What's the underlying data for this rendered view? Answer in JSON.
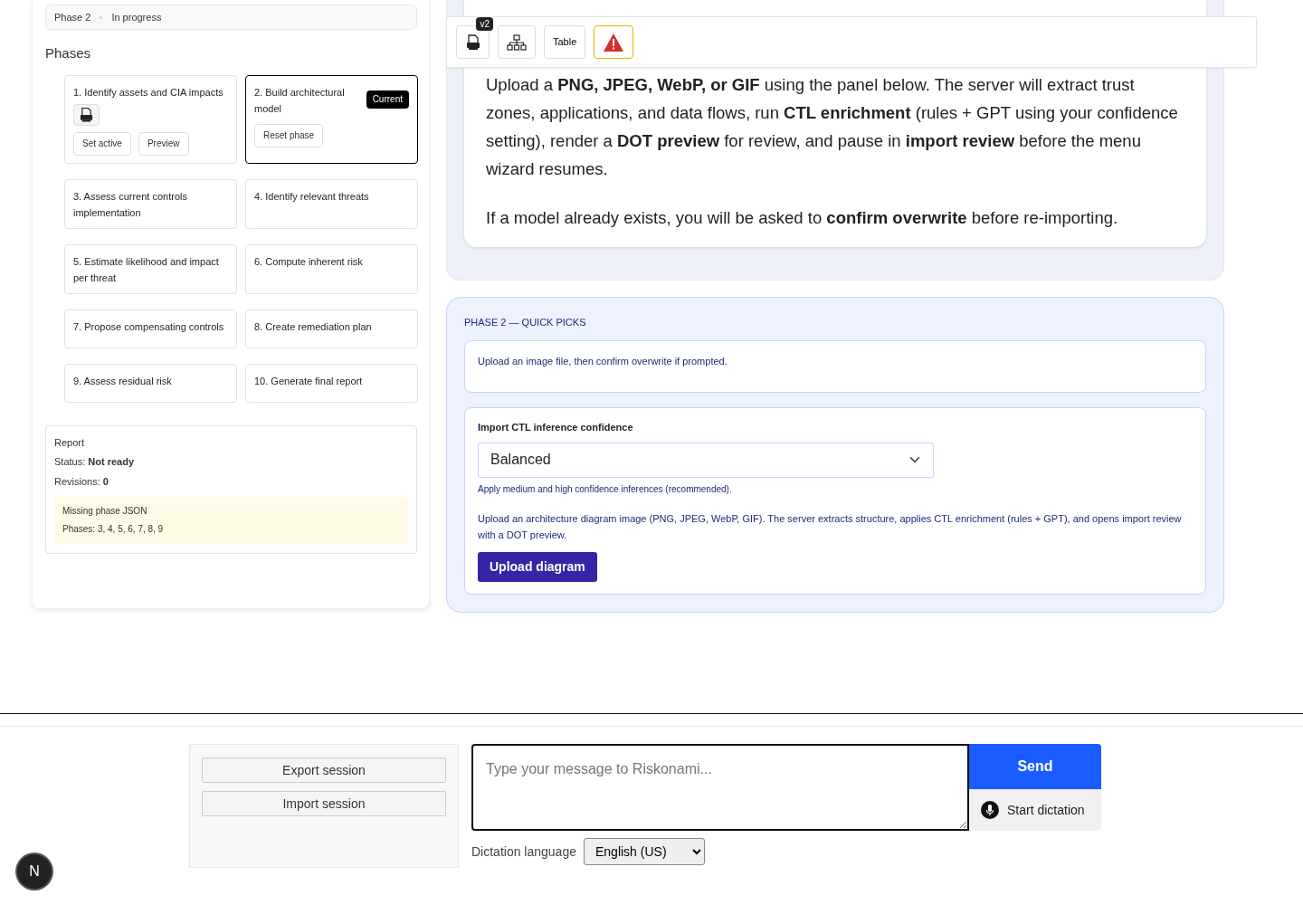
{
  "status_bar": {
    "phase": "Phase 2",
    "status": "In progress"
  },
  "phases_heading": "Phases",
  "phases": [
    {
      "label": "1. Identify assets and CIA impacts",
      "selected": false,
      "has_json": true,
      "actions": [
        "Set active",
        "Preview"
      ]
    },
    {
      "label": "2. Build architectural model",
      "selected": true,
      "badge": "Current",
      "has_json": false,
      "actions": [
        "Reset phase"
      ]
    },
    {
      "label": "3. Assess current controls implementation",
      "selected": false,
      "has_json": false
    },
    {
      "label": "4. Identify relevant threats",
      "selected": false,
      "has_json": false
    },
    {
      "label": "5. Estimate likelihood and impact per threat",
      "selected": false,
      "has_json": false
    },
    {
      "label": "6. Compute inherent risk",
      "selected": false,
      "has_json": false
    },
    {
      "label": "7. Propose compensating controls",
      "selected": false,
      "has_json": false
    },
    {
      "label": "8. Create remediation plan",
      "selected": false,
      "has_json": false
    },
    {
      "label": "9. Assess residual risk",
      "selected": false,
      "has_json": false
    },
    {
      "label": "10. Generate final report",
      "selected": false,
      "has_json": false
    }
  ],
  "report": {
    "title": "Report",
    "status": "Status: **Not ready**",
    "revisions": "Revisions: **0**",
    "warning": {
      "title": "Missing phase JSON",
      "detail": "Phases: 3, 4, 5, 6, 7, 8, 9"
    }
  },
  "toolbar": [
    {
      "kind": "json",
      "badge": "v2"
    },
    {
      "kind": "tree"
    },
    {
      "kind": "text",
      "label": "Table"
    },
    {
      "kind": "warning"
    }
  ],
  "intro": {
    "paragraphs": [
      "Upload a **PNG, JPEG, WebP, or GIF** using the panel below. The server will extract trust zones, applications, and data flows, run **CTL enrichment** (rules + GPT using your confidence setting), render a **DOT preview** for review, and pause in **import review** before the menu wizard resumes.",
      "If a model already exists, you will be asked to **confirm overwrite** before re-importing."
    ]
  },
  "quick_picks": {
    "title": "PHASE 2 — QUICK PICKS",
    "hint": "Upload an image file, then confirm overwrite if prompted.",
    "confidence_label": "Import CTL inference confidence",
    "confidence_value": "Balanced",
    "confidence_help": "Apply medium and high confidence inferences (recommended).",
    "description": "Upload an architecture diagram image (PNG, JPEG, WebP, GIF). The server extracts structure, applies CTL enrichment (rules + GPT), and opens import review with a DOT preview.",
    "upload_button": "Upload diagram"
  },
  "composer": {
    "session_buttons": [
      "Export session",
      "Import session"
    ],
    "placeholder": "Type your message to Riskonami...",
    "send": "Send",
    "dictation": "Start dictation",
    "language_label": "Dictation language",
    "language_value": "English (US)"
  },
  "avatar": "N"
}
